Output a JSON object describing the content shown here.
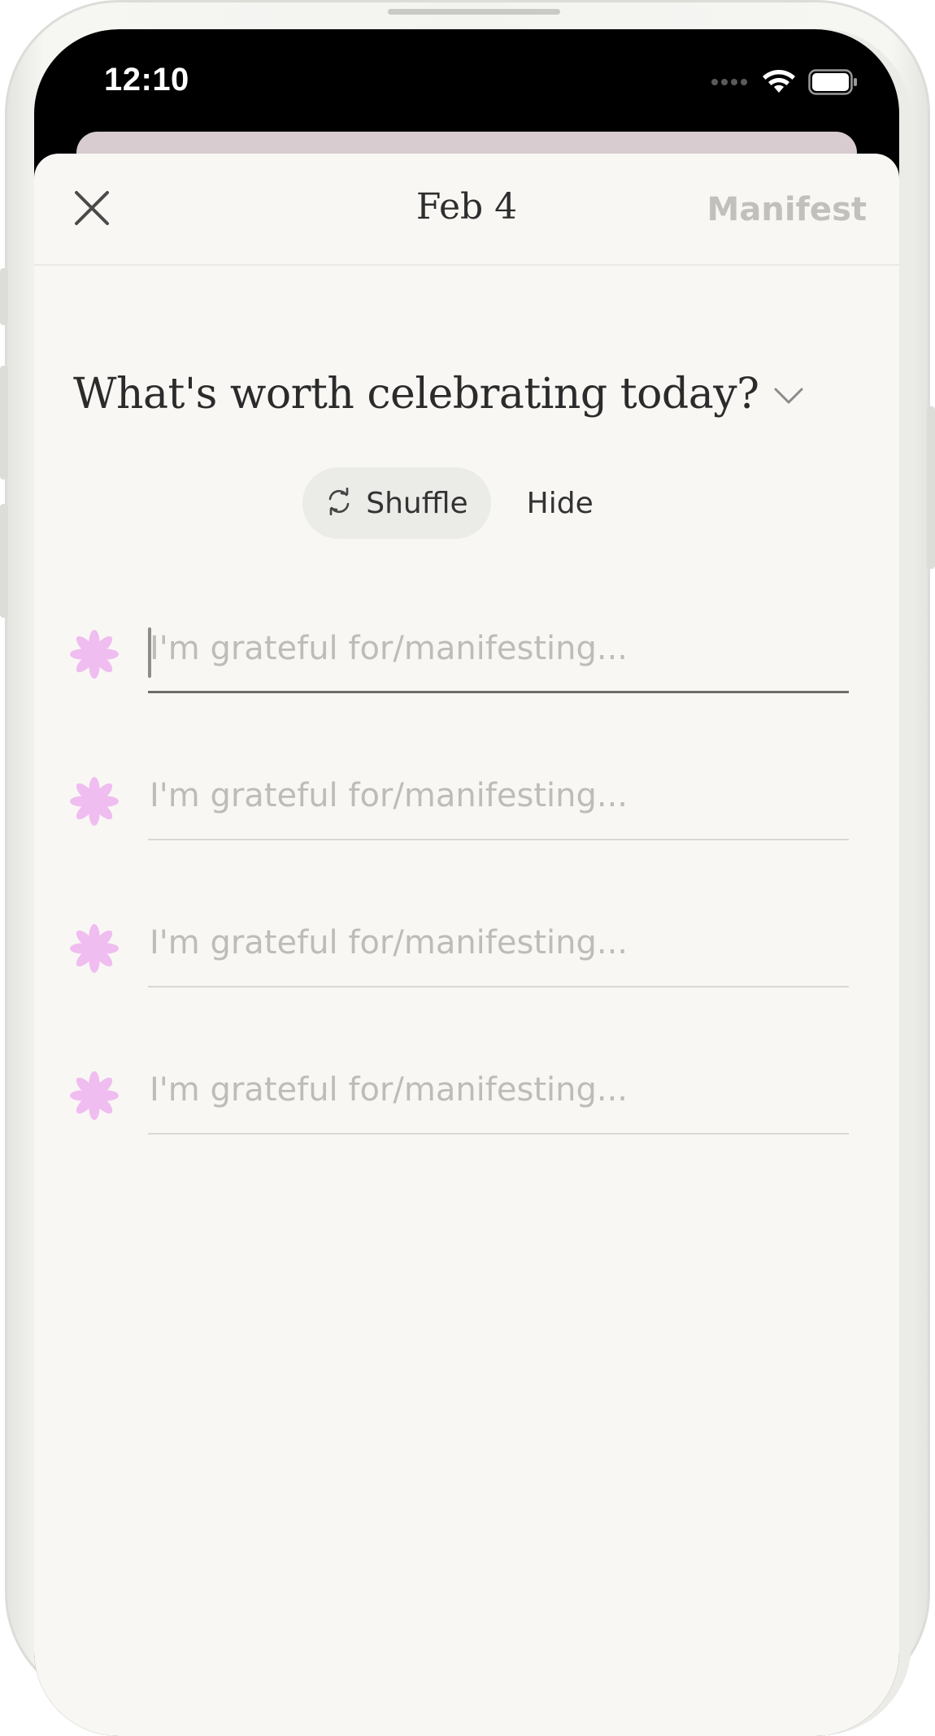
{
  "status_bar": {
    "time": "12:10"
  },
  "nav": {
    "title": "Feb 4",
    "manifest_label": "Manifest"
  },
  "prompt": {
    "question": "What's worth celebrating today?"
  },
  "actions": {
    "shuffle_label": "Shuffle",
    "hide_label": "Hide"
  },
  "entries": [
    {
      "placeholder": "I'm grateful for/manifesting...",
      "value": "",
      "focused": true
    },
    {
      "placeholder": "I'm grateful for/manifesting...",
      "value": "",
      "focused": false
    },
    {
      "placeholder": "I'm grateful for/manifesting...",
      "value": "",
      "focused": false
    },
    {
      "placeholder": "I'm grateful for/manifesting...",
      "value": "",
      "focused": false
    }
  ],
  "colors": {
    "sheet_background": "#f8f7f4",
    "flower_accent": "#f0bdf0",
    "manifest_disabled": "#c1c0bc",
    "shuffle_pill": "#ebebe8"
  },
  "icons": {
    "close": "close-icon",
    "chevron": "chevron-down-icon",
    "shuffle": "shuffle-icon",
    "flower": "flower-icon",
    "signal": "cellular-signal-icon",
    "wifi": "wifi-icon",
    "battery": "battery-icon"
  }
}
